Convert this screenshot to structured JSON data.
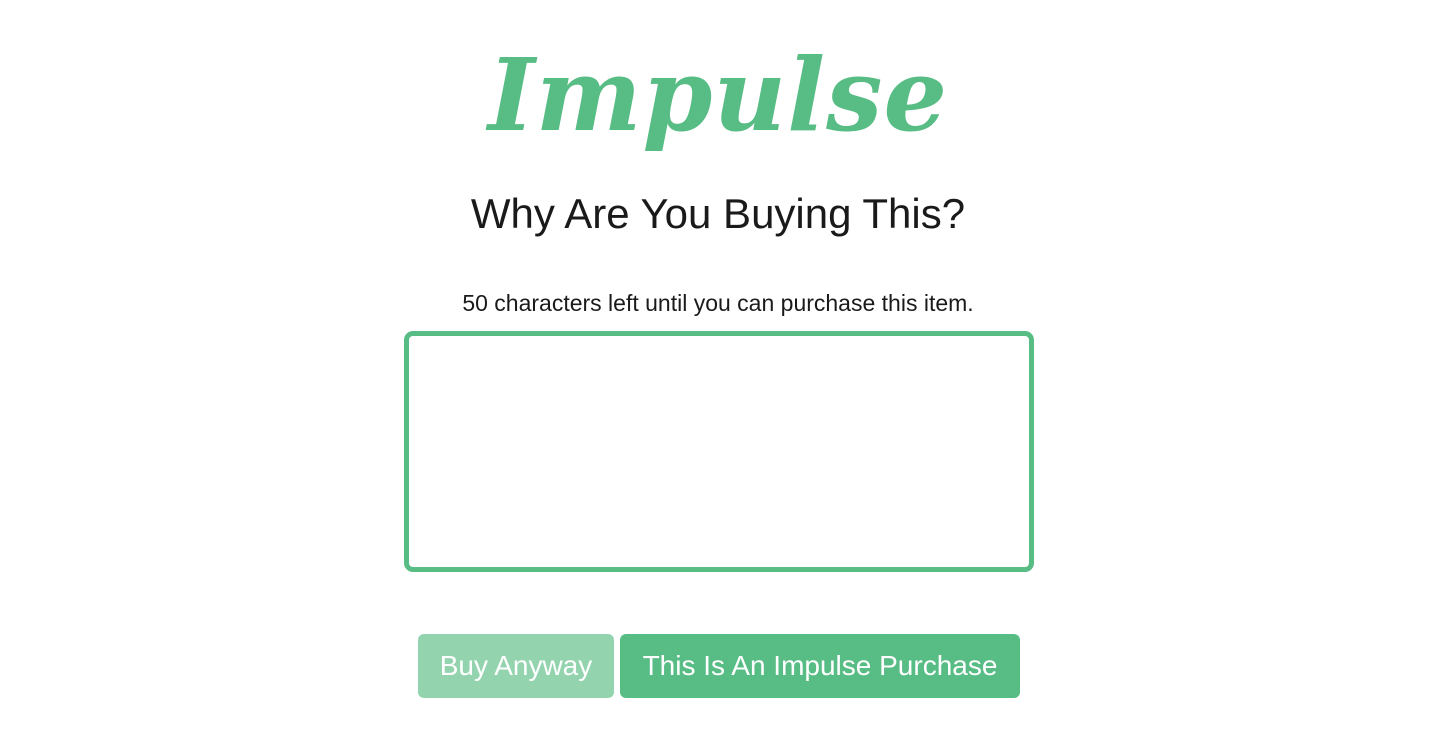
{
  "app": {
    "logo_text": "Impulse",
    "heading": "Why Are You Buying This?"
  },
  "form": {
    "counter_text": "50 characters left until you can purchase this item.",
    "reason_value": "",
    "reason_placeholder": ""
  },
  "buttons": {
    "buy_anyway_label": "Buy Anyway",
    "impulse_label": "This Is An Impulse Purchase"
  },
  "colors": {
    "brand_green": "#58bd85",
    "disabled_green": "#93d4af"
  }
}
